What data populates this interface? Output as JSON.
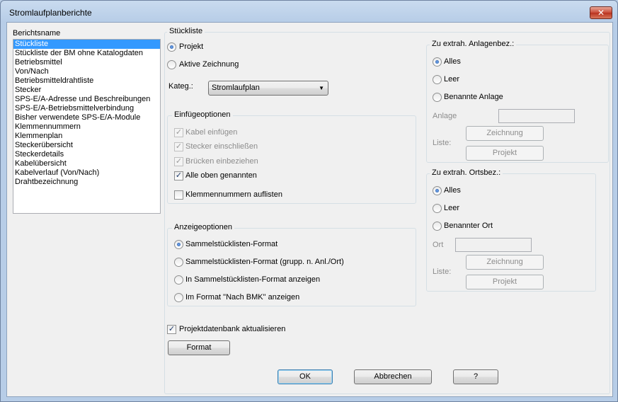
{
  "window": {
    "title": "Stromlaufplanberichte",
    "close_label": "✕"
  },
  "report_list": {
    "label": "Berichtsname",
    "items": [
      "Stückliste",
      "Stückliste der BM ohne Katalogdaten",
      "Betriebsmittel",
      "Von/Nach",
      "Betriebsmitteldrahtliste",
      "Stecker",
      "SPS-E/A-Adresse und Beschreibungen",
      "SPS-E/A-Betriebsmittelverbindung",
      "Bisher verwendete SPS-E/A-Module",
      "Klemmennummern",
      "Klemmenplan",
      "Steckerübersicht",
      "Steckerdetails",
      "Kabelübersicht",
      "Kabelverlauf (Von/Nach)",
      "Drahtbezeichnung"
    ],
    "selected": "Stückliste"
  },
  "stueckliste": {
    "legend": "Stückliste",
    "projekt_label": "Projekt",
    "aktive_zeichnung_label": "Aktive Zeichnung",
    "kateg_label": "Kateg.:",
    "kateg_value": "Stromlaufplan",
    "combo_arrow": "▼"
  },
  "einfuege": {
    "legend": "Einfügeoptionen",
    "kabel": "Kabel einfügen",
    "stecker": "Stecker einschließen",
    "bruecken": "Brücken einbeziehen",
    "alle": "Alle oben genannten",
    "klemmen": "Klemmennummern auflisten",
    "check_mark": "✓"
  },
  "anzeige": {
    "legend": "Anzeigeoptionen",
    "opt1": "Sammelstücklisten-Format",
    "opt2": "Sammelstücklisten-Format (grupp. n. Anl./Ort)",
    "opt3": "In Sammelstücklisten-Format anzeigen",
    "opt4": "Im Format \"Nach BMK\" anzeigen"
  },
  "anlagen": {
    "legend": "Zu extrah. Anlagenbez.:",
    "alles": "Alles",
    "leer": "Leer",
    "benannte": "Benannte Anlage",
    "field_label": "Anlage",
    "liste_label": "Liste:",
    "zeichnung_btn": "Zeichnung",
    "projekt_btn": "Projekt"
  },
  "orts": {
    "legend": "Zu extrah. Ortsbez.:",
    "alles": "Alles",
    "leer": "Leer",
    "benannter": "Benannter Ort",
    "field_label": "Ort",
    "liste_label": "Liste:",
    "zeichnung_btn": "Zeichnung",
    "projekt_btn": "Projekt"
  },
  "footer": {
    "db_update_label": "Projektdatenbank aktualisieren",
    "format_btn": "Format",
    "ok_btn": "OK",
    "cancel_btn": "Abbrechen",
    "help_btn": "?"
  },
  "colors": {
    "selection": "#3399ff",
    "accent": "#1f4f9c"
  }
}
